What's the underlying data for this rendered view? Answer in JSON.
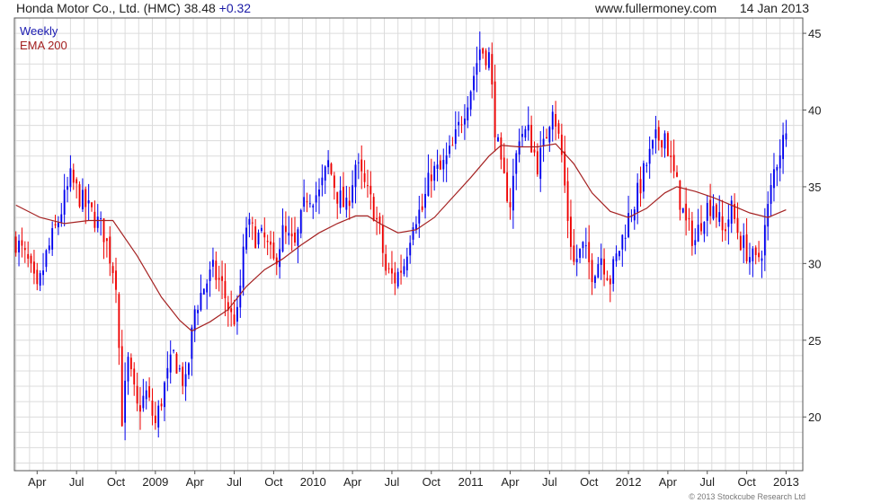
{
  "header": {
    "title": "Honda Motor Co., Ltd. (HMC)",
    "last": "38.48",
    "change": "+0.32",
    "site": "www.fullermoney.com",
    "date": "14 Jan 2013"
  },
  "footer": {
    "copyright": "© 2013 Stockcube Research Ltd"
  },
  "colors": {
    "up": "#0000ee",
    "down": "#ee0000",
    "ema": "#a52222",
    "grid": "#dcdcdc"
  },
  "chart_data": {
    "type": "candlestick",
    "ylim": [
      16.5,
      46
    ],
    "y_ticks": [
      20,
      25,
      30,
      35,
      40,
      45
    ],
    "x_ticks": [
      {
        "label": "Apr",
        "week": 7
      },
      {
        "label": "Jul",
        "week": 20
      },
      {
        "label": "Oct",
        "week": 33
      },
      {
        "label": "2009",
        "week": 46
      },
      {
        "label": "Apr",
        "week": 59
      },
      {
        "label": "Jul",
        "week": 72
      },
      {
        "label": "Oct",
        "week": 85
      },
      {
        "label": "2010",
        "week": 98
      },
      {
        "label": "Apr",
        "week": 111
      },
      {
        "label": "Jul",
        "week": 124
      },
      {
        "label": "Oct",
        "week": 137
      },
      {
        "label": "2011",
        "week": 150
      },
      {
        "label": "Apr",
        "week": 163
      },
      {
        "label": "Jul",
        "week": 176
      },
      {
        "label": "Oct",
        "week": 189
      },
      {
        "label": "2012",
        "week": 202
      },
      {
        "label": "Apr",
        "week": 215
      },
      {
        "label": "Jul",
        "week": 228
      },
      {
        "label": "Oct",
        "week": 241
      },
      {
        "label": "2013",
        "week": 254
      }
    ],
    "series": [
      {
        "name": "Weekly",
        "type": "ohlc-candles",
        "anchors": [
          [
            0,
            31.5
          ],
          [
            4,
            30.0
          ],
          [
            7,
            28.0
          ],
          [
            10,
            30.5
          ],
          [
            14,
            32.8
          ],
          [
            18,
            35.5
          ],
          [
            22,
            34.0
          ],
          [
            26,
            33.0
          ],
          [
            29,
            32.0
          ],
          [
            33,
            29.0
          ],
          [
            35,
            20.0
          ],
          [
            37,
            23.5
          ],
          [
            40,
            20.5
          ],
          [
            43,
            21.5
          ],
          [
            46,
            19.5
          ],
          [
            49,
            22.0
          ],
          [
            52,
            24.0
          ],
          [
            56,
            22.0
          ],
          [
            59,
            27.0
          ],
          [
            62,
            28.5
          ],
          [
            65,
            29.5
          ],
          [
            68,
            28.5
          ],
          [
            71,
            26.5
          ],
          [
            73,
            26.5
          ],
          [
            76,
            32.5
          ],
          [
            79,
            31.8
          ],
          [
            82,
            31.5
          ],
          [
            85,
            30.0
          ],
          [
            88,
            32.0
          ],
          [
            92,
            31.0
          ],
          [
            96,
            34.5
          ],
          [
            100,
            34.5
          ],
          [
            103,
            36.5
          ],
          [
            106,
            34.5
          ],
          [
            109,
            33.5
          ],
          [
            112,
            36.5
          ],
          [
            115,
            35.0
          ],
          [
            118,
            33.5
          ],
          [
            120,
            32.0
          ],
          [
            122,
            29.5
          ],
          [
            125,
            29.0
          ],
          [
            128,
            30.0
          ],
          [
            131,
            33.0
          ],
          [
            134,
            33.5
          ],
          [
            137,
            36.0
          ],
          [
            140,
            36.0
          ],
          [
            144,
            37.5
          ],
          [
            147,
            39.5
          ],
          [
            150,
            41.5
          ],
          [
            153,
            44.0
          ],
          [
            156,
            43.5
          ],
          [
            158,
            39.0
          ],
          [
            160,
            36.0
          ],
          [
            163,
            34.0
          ],
          [
            166,
            38.5
          ],
          [
            169,
            38.5
          ],
          [
            172,
            36.5
          ],
          [
            174,
            37.5
          ],
          [
            177,
            40.5
          ],
          [
            180,
            37.0
          ],
          [
            182,
            33.0
          ],
          [
            184,
            30.0
          ],
          [
            187,
            31.0
          ],
          [
            190,
            29.5
          ],
          [
            193,
            30.5
          ],
          [
            196,
            29.0
          ],
          [
            199,
            31.0
          ],
          [
            202,
            33.0
          ],
          [
            205,
            34.5
          ],
          [
            208,
            36.5
          ],
          [
            211,
            38.0
          ],
          [
            214,
            38.5
          ],
          [
            216,
            36.5
          ],
          [
            218,
            35.0
          ],
          [
            221,
            32.5
          ],
          [
            224,
            31.5
          ],
          [
            227,
            33.5
          ],
          [
            230,
            34.0
          ],
          [
            233,
            32.0
          ],
          [
            236,
            33.5
          ],
          [
            239,
            31.5
          ],
          [
            242,
            30.5
          ],
          [
            244,
            30.0
          ],
          [
            246,
            31.0
          ],
          [
            248,
            33.5
          ],
          [
            250,
            36.0
          ],
          [
            252,
            37.5
          ],
          [
            254,
            38.48
          ]
        ]
      },
      {
        "name": "EMA 200",
        "type": "line",
        "points": [
          [
            0,
            33.8
          ],
          [
            8,
            33.0
          ],
          [
            16,
            32.6
          ],
          [
            24,
            32.8
          ],
          [
            32,
            32.8
          ],
          [
            40,
            30.5
          ],
          [
            48,
            27.8
          ],
          [
            54,
            26.3
          ],
          [
            58,
            25.6
          ],
          [
            64,
            26.2
          ],
          [
            70,
            27.0
          ],
          [
            76,
            28.5
          ],
          [
            82,
            29.6
          ],
          [
            88,
            30.3
          ],
          [
            94,
            31.2
          ],
          [
            100,
            32.0
          ],
          [
            106,
            32.6
          ],
          [
            112,
            33.1
          ],
          [
            116,
            33.1
          ],
          [
            120,
            32.6
          ],
          [
            126,
            32.0
          ],
          [
            132,
            32.2
          ],
          [
            138,
            33.0
          ],
          [
            144,
            34.3
          ],
          [
            150,
            35.6
          ],
          [
            156,
            37.0
          ],
          [
            160,
            37.7
          ],
          [
            166,
            37.6
          ],
          [
            172,
            37.6
          ],
          [
            178,
            37.8
          ],
          [
            184,
            36.5
          ],
          [
            190,
            34.6
          ],
          [
            196,
            33.4
          ],
          [
            202,
            33.0
          ],
          [
            208,
            33.6
          ],
          [
            214,
            34.6
          ],
          [
            218,
            35.0
          ],
          [
            224,
            34.7
          ],
          [
            230,
            34.3
          ],
          [
            236,
            33.8
          ],
          [
            242,
            33.3
          ],
          [
            248,
            33.0
          ],
          [
            254,
            33.5
          ]
        ]
      }
    ]
  }
}
